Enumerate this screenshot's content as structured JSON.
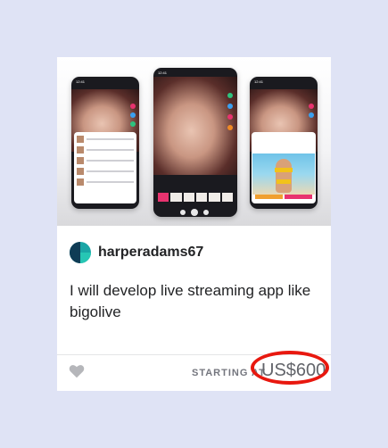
{
  "gig": {
    "seller_name": "harperadams67",
    "title": "I will develop live streaming app like bigolive",
    "starting_label": "STARTING AT",
    "price": "US$600"
  },
  "preview": {
    "status_time": "12:41",
    "carousel_dots": 3,
    "active_dot": 1
  },
  "colors": {
    "background": "#dfe3f5",
    "card": "#ffffff",
    "highlight_circle": "#e8180f",
    "brand_pink": "#e8336f"
  }
}
